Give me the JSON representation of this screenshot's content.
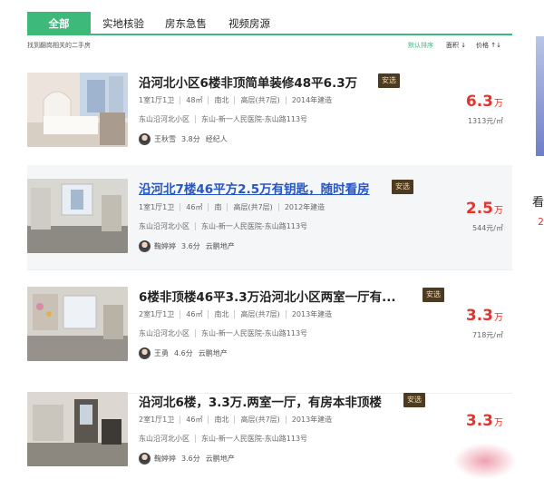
{
  "tabs": [
    {
      "label": "全部"
    },
    {
      "label": "实地核验"
    },
    {
      "label": "房东急售"
    },
    {
      "label": "视频房源"
    }
  ],
  "subbar": {
    "summary": "找到翻岗相关的二手房",
    "sort_default": "默认排序",
    "sort_area": "面积 ↓",
    "sort_price": "价格 ↑↓"
  },
  "right_panel": {
    "text1": "看",
    "text2": "2"
  },
  "colors": {
    "accent": "#3db97a",
    "price": "#e8322b",
    "badge_bg": "#4c3a23",
    "link": "#2656c6"
  },
  "listings": [
    {
      "title": "沿河北小区6楼非顶简单装修48平6.3万",
      "badge": "安选",
      "specs": [
        "1室1厅1卫",
        "48㎡",
        "南北",
        "高层(共7层)",
        "2014年建造"
      ],
      "address": [
        "东山沿河北小区",
        "东山-新一人民医院-东山路113号"
      ],
      "agent": {
        "name": "王秋雪",
        "score": "3.8分",
        "company": "经纪人"
      },
      "price": "6.3",
      "price_unit": "万",
      "unit_price": "1313元/㎡"
    },
    {
      "title": "沿河北7楼46平方2.5万有钥匙，随时看房",
      "badge": "安选",
      "specs": [
        "1室1厅1卫",
        "46㎡",
        "南",
        "高层(共7层)",
        "2012年建造"
      ],
      "address": [
        "东山沿河北小区",
        "东山-新一人民医院-东山路113号"
      ],
      "agent": {
        "name": "鞠婷婷",
        "score": "3.6分",
        "company": "云鹏地产"
      },
      "price": "2.5",
      "price_unit": "万",
      "unit_price": "544元/㎡"
    },
    {
      "title": "6楼非顶楼46平3.3万沿河北小区两室一厅有...",
      "badge": "安选",
      "specs": [
        "2室1厅1卫",
        "46㎡",
        "南北",
        "高层(共7层)",
        "2013年建造"
      ],
      "address": [
        "东山沿河北小区",
        "东山-新一人民医院-东山路113号"
      ],
      "agent": {
        "name": "王勇",
        "score": "4.6分",
        "company": "云鹏地产"
      },
      "price": "3.3",
      "price_unit": "万",
      "unit_price": "718元/㎡"
    },
    {
      "title": "沿河北6楼，3.3万.两室一厅，有房本非顶楼",
      "badge": "安选",
      "specs": [
        "2室1厅1卫",
        "46㎡",
        "南北",
        "高层(共7层)",
        "2013年建造"
      ],
      "address": [
        "东山沿河北小区",
        "东山-新一人民医院-东山路113号"
      ],
      "agent": {
        "name": "鞠婷婷",
        "score": "3.6分",
        "company": "云鹏地产"
      },
      "price": "3.3",
      "price_unit": "万",
      "unit_price": ""
    }
  ]
}
